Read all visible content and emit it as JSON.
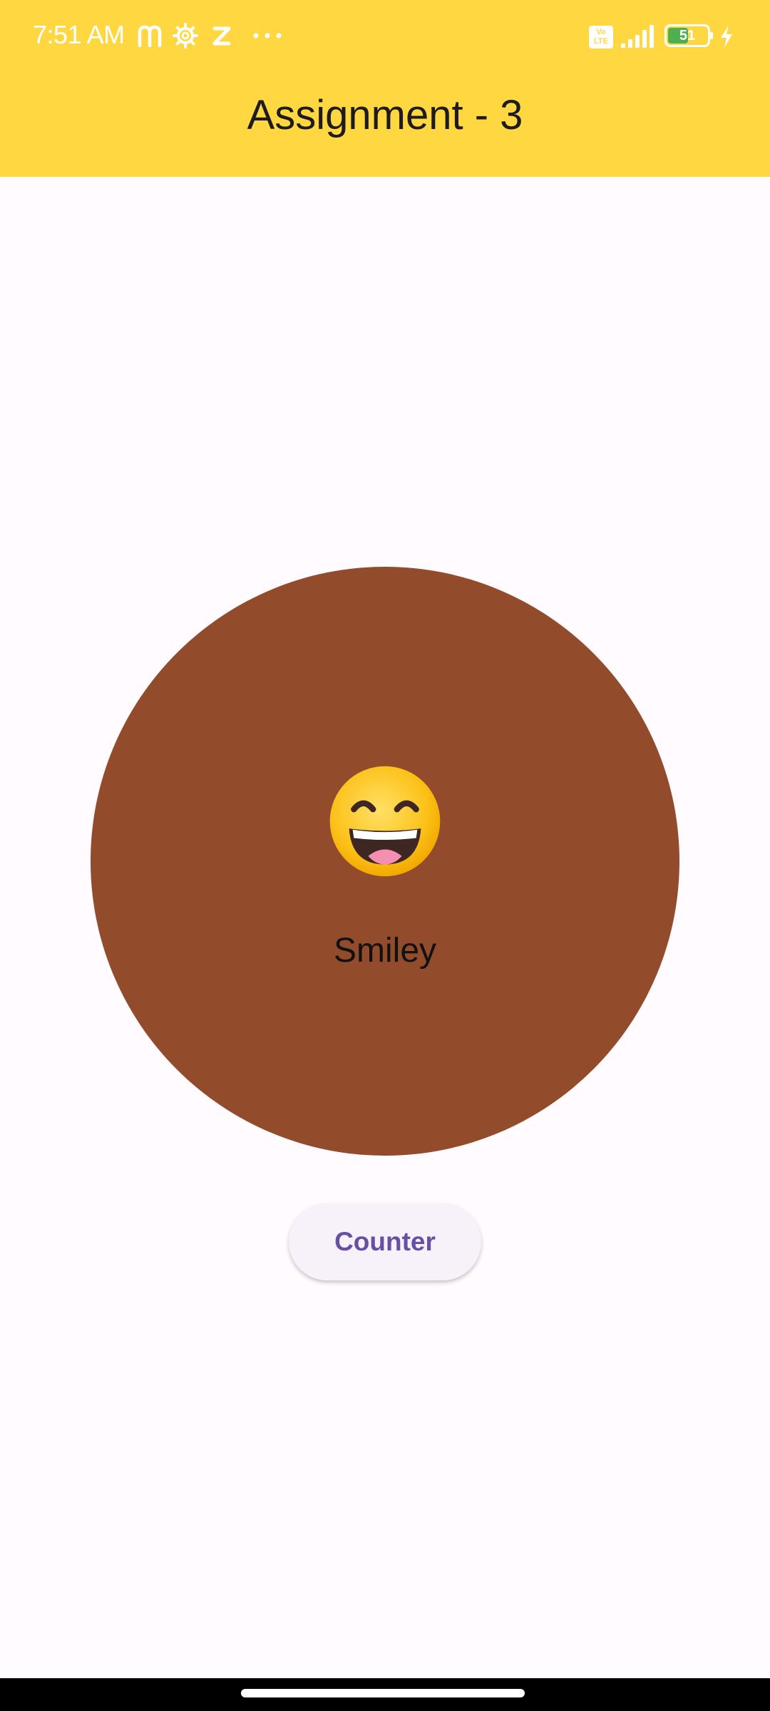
{
  "status_bar": {
    "time": "7:51 AM",
    "volte_label": "Vo LTE",
    "battery_level": "51",
    "icons": [
      "m-app-icon",
      "gear-icon",
      "z-app-icon",
      "more-dots-icon",
      "volte-icon",
      "signal-icon",
      "battery-icon",
      "charging-icon"
    ]
  },
  "app_bar": {
    "title": "Assignment - 3",
    "color": "#FFD740"
  },
  "card": {
    "circle_color": "#924C2C",
    "emoji_icon": "grinning-face-icon",
    "label": "Smiley"
  },
  "counter_button": {
    "label": "Counter",
    "text_color": "#6750A4"
  },
  "nav_bar": {
    "handle": "home-handle"
  }
}
